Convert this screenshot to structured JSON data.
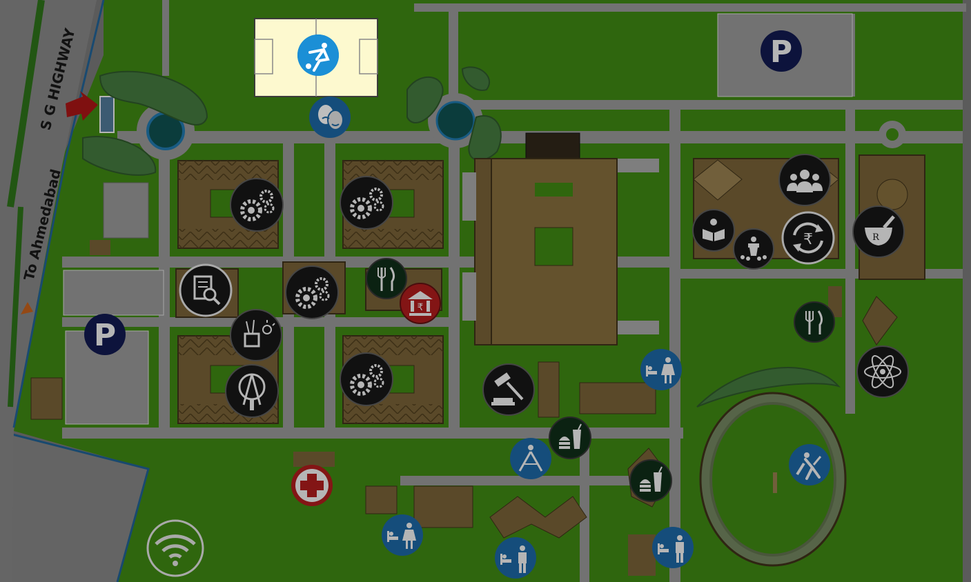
{
  "map": {
    "highway_label": "S G HIGHWAY",
    "direction_label": "To Ahmedabad"
  },
  "colors": {
    "grass": "#3a7d12",
    "road": "#8b8b8b",
    "building": "#6e5a32",
    "building_light": "#8a7548",
    "pin_dark": "#151515",
    "pin_blue": "#1a5f96",
    "pin_green": "#0e2a17",
    "pin_red": "#a01a1a",
    "highlight_bg": "#fdf9cf",
    "highlight_pin": "#1b8fd6"
  },
  "highlight": {
    "icon": "football-icon",
    "state": "selected"
  },
  "pois": [
    {
      "icon": "football-icon",
      "category": "sports",
      "color": "blue"
    },
    {
      "icon": "drama-masks-icon",
      "category": "theatre",
      "color": "blue"
    },
    {
      "icon": "gears-icon",
      "category": "engineering",
      "color": "dark"
    },
    {
      "icon": "gears-icon",
      "category": "engineering",
      "color": "dark"
    },
    {
      "icon": "gears-icon",
      "category": "engineering",
      "color": "dark"
    },
    {
      "icon": "gears-icon",
      "category": "engineering",
      "color": "dark"
    },
    {
      "icon": "research-document-icon",
      "category": "research",
      "color": "dark"
    },
    {
      "icon": "design-tools-icon",
      "category": "design",
      "color": "dark"
    },
    {
      "icon": "architecture-compass-icon",
      "category": "architecture",
      "color": "dark"
    },
    {
      "icon": "cutlery-icon",
      "category": "canteen",
      "color": "green"
    },
    {
      "icon": "cutlery-icon",
      "category": "canteen",
      "color": "green"
    },
    {
      "icon": "rupee-bank-icon",
      "category": "bank",
      "color": "red"
    },
    {
      "icon": "gavel-icon",
      "category": "law",
      "color": "dark"
    },
    {
      "icon": "food-icon",
      "category": "food-court",
      "color": "green"
    },
    {
      "icon": "food-icon",
      "category": "food-court",
      "color": "green"
    },
    {
      "icon": "meeting-people-icon",
      "category": "management",
      "color": "dark"
    },
    {
      "icon": "reading-icon",
      "category": "library",
      "color": "dark"
    },
    {
      "icon": "lecture-podium-icon",
      "category": "auditorium",
      "color": "dark"
    },
    {
      "icon": "rupee-exchange-icon",
      "category": "finance",
      "color": "dark"
    },
    {
      "icon": "pharmacy-icon",
      "category": "pharmacy",
      "color": "dark"
    },
    {
      "icon": "atom-icon",
      "category": "science",
      "color": "dark"
    },
    {
      "icon": "female-hostel-icon",
      "category": "girls-hostel",
      "color": "blue"
    },
    {
      "icon": "female-hostel-icon",
      "category": "girls-hostel",
      "color": "blue"
    },
    {
      "icon": "male-hostel-icon",
      "category": "boys-hostel",
      "color": "blue"
    },
    {
      "icon": "male-hostel-icon",
      "category": "boys-hostel",
      "color": "blue"
    },
    {
      "icon": "badminton-icon",
      "category": "indoor-sports",
      "color": "blue"
    },
    {
      "icon": "cricket-icon",
      "category": "cricket",
      "color": "blue"
    },
    {
      "icon": "parking-icon",
      "category": "parking",
      "color": "navy"
    },
    {
      "icon": "parking-icon",
      "category": "parking",
      "color": "navy"
    },
    {
      "icon": "medical-cross-icon",
      "category": "medical",
      "color": "red"
    },
    {
      "icon": "wifi-icon",
      "category": "wifi-zone",
      "color": "outline"
    }
  ]
}
